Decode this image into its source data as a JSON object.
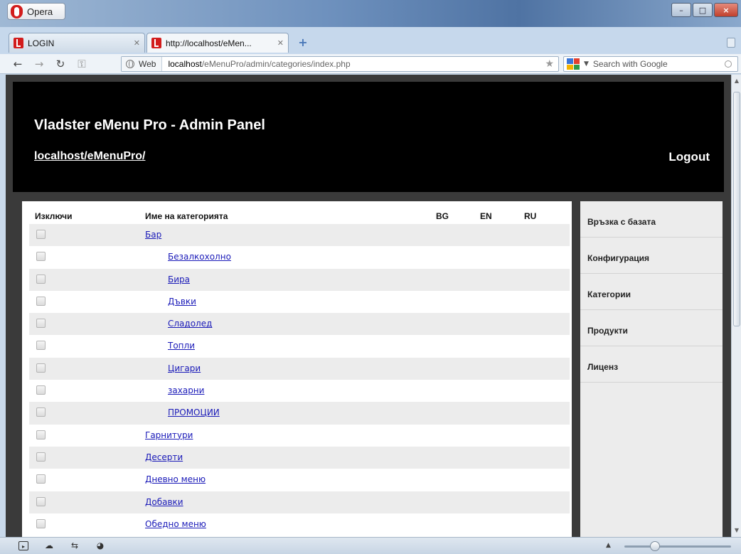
{
  "window": {
    "app_name": "Opera",
    "controls": [
      "–",
      "□",
      "×"
    ]
  },
  "tabs": [
    {
      "title": "LOGIN",
      "active": false
    },
    {
      "title": "http://localhost/eMen...",
      "active": true
    }
  ],
  "address_bar": {
    "badge": "Web",
    "url_host": "localhost",
    "url_path": "/eMenuPro/admin/categories/index.php",
    "search_placeholder": "Search with Google"
  },
  "header": {
    "title": "Vladster eMenu Pro - Admin Panel",
    "site_link": "localhost/eMenuPro/",
    "logout": "Logout"
  },
  "table": {
    "columns": [
      "Изключи",
      "Име на категорията",
      "BG",
      "EN",
      "RU"
    ],
    "rows": [
      {
        "name": "Бар",
        "level": 0
      },
      {
        "name": " Безалкохолно",
        "level": 1
      },
      {
        "name": " Бира",
        "level": 1
      },
      {
        "name": " Дъвки",
        "level": 1
      },
      {
        "name": " Сладолед",
        "level": 1
      },
      {
        "name": " Топли",
        "level": 1
      },
      {
        "name": " Цигари",
        "level": 1
      },
      {
        "name": " захарни",
        "level": 1
      },
      {
        "name": " ПРОМОЦИИ",
        "level": 1
      },
      {
        "name": "Гарнитури",
        "level": 0
      },
      {
        "name": "Десерти",
        "level": 0
      },
      {
        "name": "Дневно меню",
        "level": 0
      },
      {
        "name": "Добавки",
        "level": 0
      },
      {
        "name": "Обедно меню",
        "level": 0
      }
    ]
  },
  "sidebar": {
    "items": [
      "Връзка с базата",
      "Конфигурация",
      "Категории",
      "Продукти",
      "Лиценз"
    ]
  },
  "statusbar": {
    "icons": [
      "panel-icon",
      "cloud-icon",
      "share-icon",
      "speed-dial-icon"
    ]
  }
}
